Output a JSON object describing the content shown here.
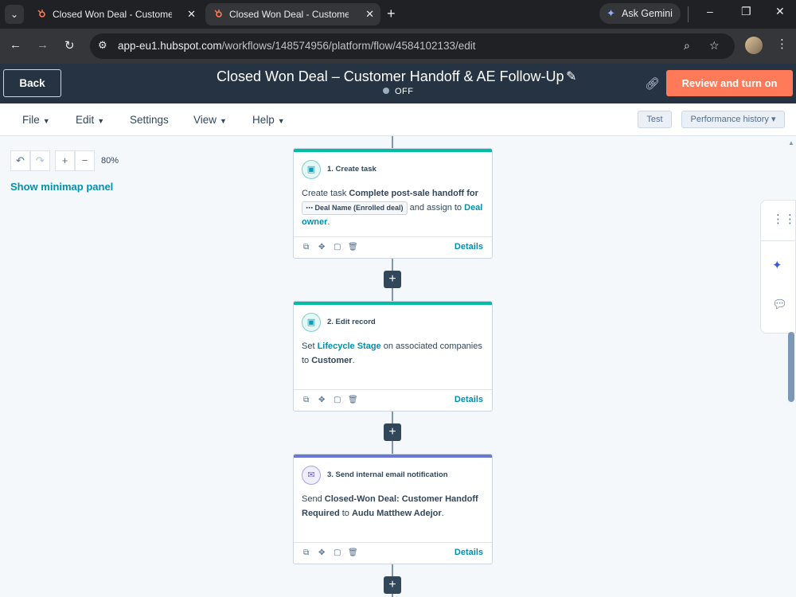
{
  "browser": {
    "tabs": [
      {
        "title": "Closed Won Deal - Customer H",
        "active": false
      },
      {
        "title": "Closed Won Deal - Customer H",
        "active": true
      }
    ],
    "new_tab": "+",
    "gemini_label": "Ask Gemini",
    "url_host": "app-eu1.hubspot.com",
    "url_path": "/workflows/148574956/platform/flow/4584102133/edit",
    "window_controls": {
      "minimize": "–",
      "restore": "❐",
      "close": "✕"
    }
  },
  "header": {
    "back_label": "Back",
    "title": "Closed Won Deal – Customer Handoff & AE Follow-Up",
    "status": "OFF",
    "review_label": "Review and turn on"
  },
  "menu": {
    "file": "File",
    "edit": "Edit",
    "settings": "Settings",
    "view": "View",
    "help": "Help",
    "test": "Test",
    "performance": "Performance history"
  },
  "canvas": {
    "zoom": "80%",
    "minimap_label": "Show minimap panel"
  },
  "cards": [
    {
      "title": "1. Create task",
      "accent": "#00bda5",
      "text_1": "Create task ",
      "bold_1": "Complete post-sale handoff for",
      "token": "Deal Name (Enrolled deal)",
      "text_2": " and assign to ",
      "link_1": "Deal owner",
      "text_3": ".",
      "details": "Details"
    },
    {
      "title": "2. Edit record",
      "accent": "#00bda5",
      "text_1": "Set ",
      "link_1": "Lifecycle Stage",
      "text_2": " on associated companies to ",
      "bold_1": "Customer",
      "text_3": ".",
      "details": "Details"
    },
    {
      "title": "3. Send internal email notification",
      "accent": "#6a78d1",
      "text_1": "Send ",
      "bold_1": "Closed-Won Deal: Customer Handoff Required",
      "text_2": " to ",
      "bold_2": "Audu Matthew Adejor",
      "text_3": ".",
      "details": "Details"
    }
  ],
  "colors": {
    "header_bg": "#253342",
    "review_btn": "#ff7a59",
    "link": "#0091ae",
    "canvas_bg": "#f5f8fa"
  }
}
